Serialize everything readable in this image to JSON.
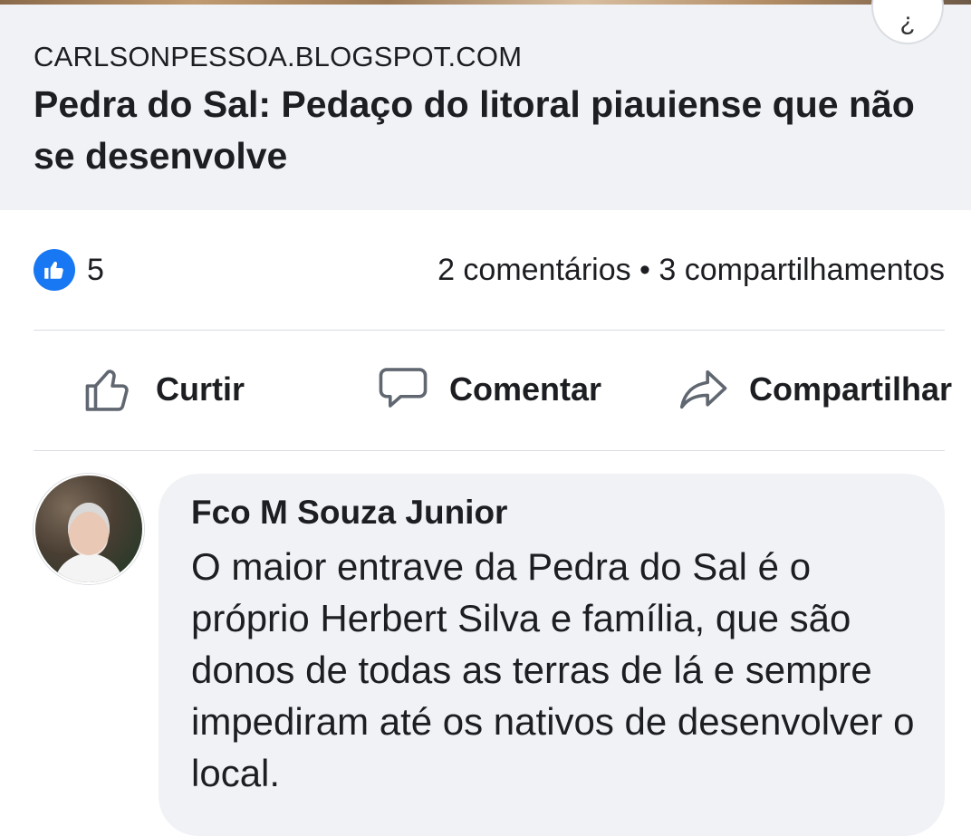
{
  "link_preview": {
    "domain": "CARLSONPESSOA.BLOGSPOT.COM",
    "title": "Pedra do Sal: Pedaço do litoral piauiense que não se desenvolve"
  },
  "help_glyph": "¿",
  "reactions": {
    "icon": "like-thumb-icon",
    "count": "5",
    "stats": "2 comentários • 3 compartilhamentos"
  },
  "actions": {
    "like_label": "Curtir",
    "comment_label": "Comentar",
    "share_label": "Compartilhar"
  },
  "comment": {
    "author": "Fco M Souza Junior",
    "text": "O maior entrave da Pedra do Sal é o próprio Herbert Silva e família, que são donos de todas as terras de lá e sempre impediram até os nativos de desenvolver o local."
  },
  "colors": {
    "accent": "#1877f2",
    "bubble": "#f0f2f5",
    "text": "#1c1e21"
  }
}
